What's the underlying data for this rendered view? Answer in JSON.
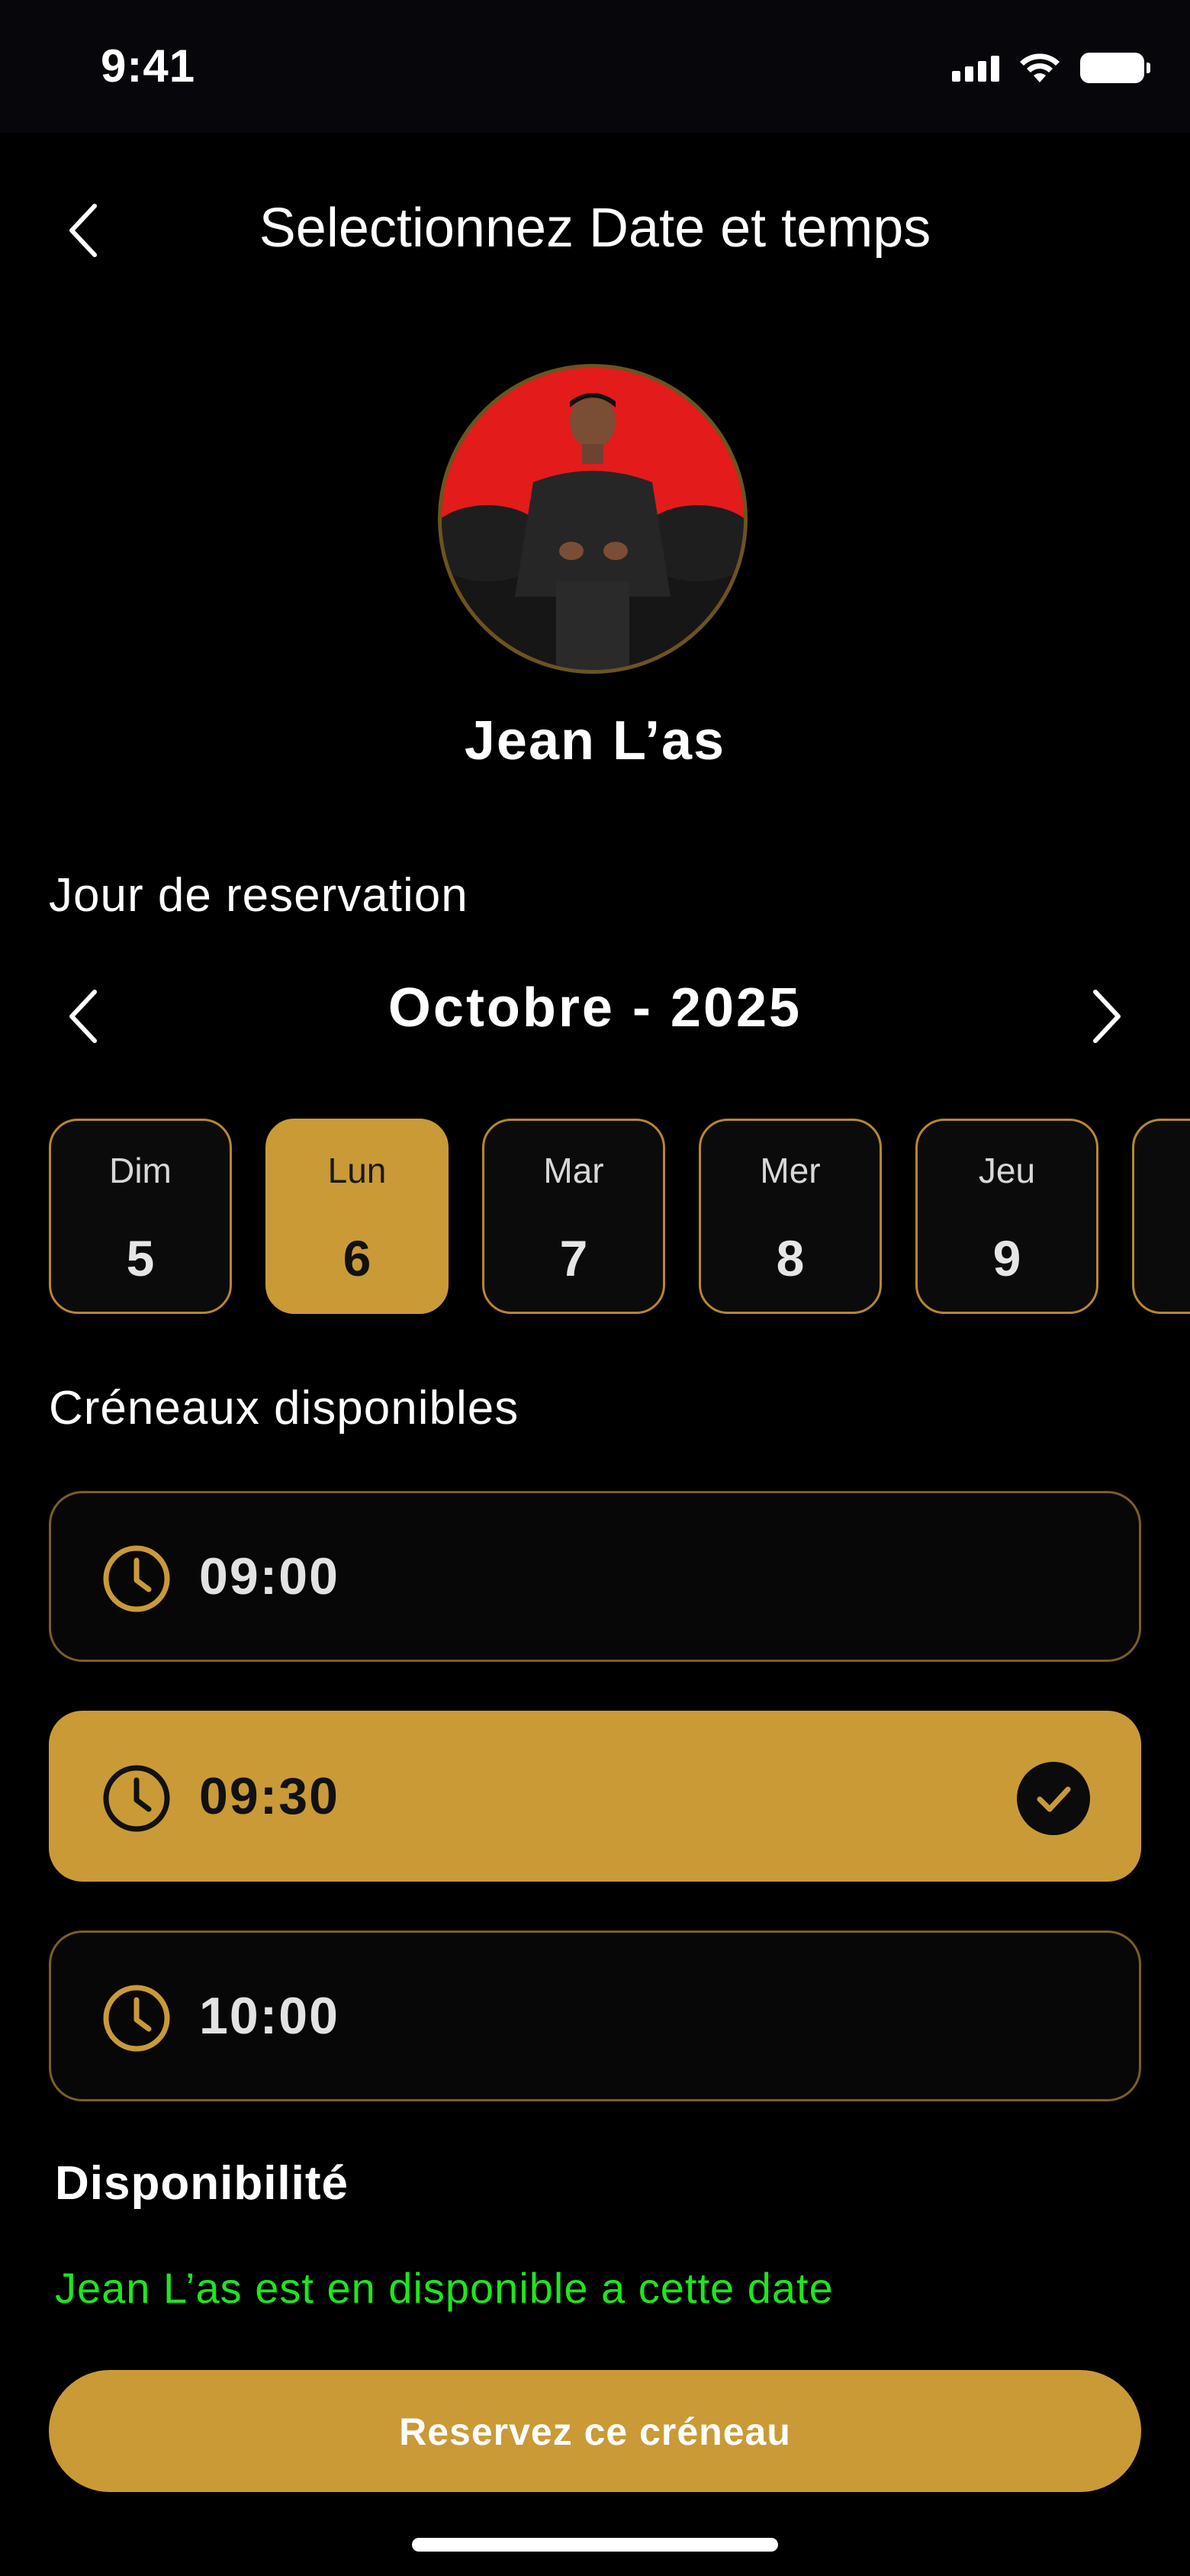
{
  "status_bar": {
    "time": "9:41"
  },
  "header": {
    "title": "Selectionnez Date et temps"
  },
  "profile": {
    "name": "Jean L’as"
  },
  "reservation": {
    "section_label": "Jour de reservation",
    "month_label": "Octobre - 2025",
    "days": [
      {
        "name": "Dim",
        "number": "5",
        "selected": false
      },
      {
        "name": "Lun",
        "number": "6",
        "selected": true
      },
      {
        "name": "Mar",
        "number": "7",
        "selected": false
      },
      {
        "name": "Mer",
        "number": "8",
        "selected": false
      },
      {
        "name": "Jeu",
        "number": "9",
        "selected": false
      }
    ]
  },
  "slots": {
    "section_label": "Créneaux disponibles",
    "items": [
      {
        "time": "09:00",
        "selected": false
      },
      {
        "time": "09:30",
        "selected": true
      },
      {
        "time": "10:00",
        "selected": false
      }
    ]
  },
  "availability": {
    "title": "Disponibilité",
    "message": "Jean L’as est en disponible a cette date"
  },
  "cta": {
    "label": "Reservez ce créneau"
  },
  "colors": {
    "accent": "#c99a36",
    "background": "#000000",
    "available_text": "#1ee61e",
    "avatar_background": "#e31b1b"
  },
  "icons": [
    "back-chevron-icon",
    "prev-month-icon",
    "next-month-icon",
    "clock-icon",
    "check-icon",
    "signal-icon",
    "wifi-icon",
    "battery-icon"
  ]
}
